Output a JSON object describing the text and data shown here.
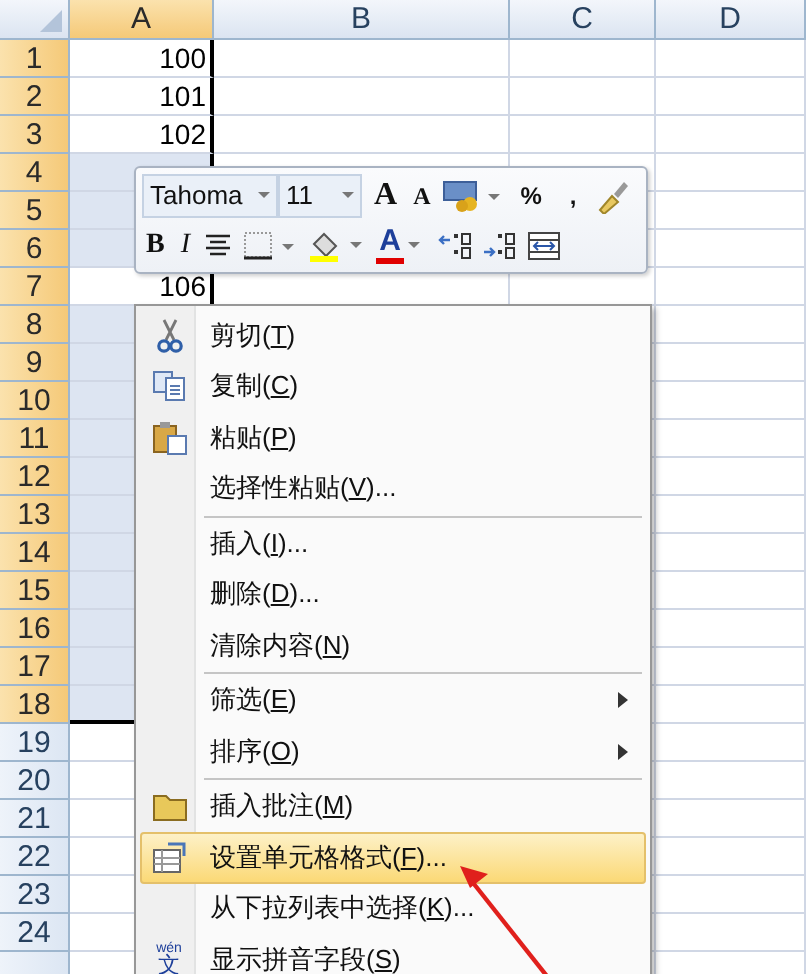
{
  "columns": [
    {
      "label": "A",
      "selected": true
    },
    {
      "label": "B",
      "selected": false
    },
    {
      "label": "C",
      "selected": false
    },
    {
      "label": "D",
      "selected": false
    }
  ],
  "rows": [
    {
      "number": "1",
      "selected": true,
      "a": "100"
    },
    {
      "number": "2",
      "selected": true,
      "a": "101"
    },
    {
      "number": "3",
      "selected": true,
      "a": "102"
    },
    {
      "number": "4",
      "selected": true
    },
    {
      "number": "5",
      "selected": true
    },
    {
      "number": "6",
      "selected": true
    },
    {
      "number": "7",
      "selected": true,
      "a": "106"
    },
    {
      "number": "8",
      "selected": true
    },
    {
      "number": "9",
      "selected": true
    },
    {
      "number": "10",
      "selected": true
    },
    {
      "number": "11",
      "selected": true
    },
    {
      "number": "12",
      "selected": true
    },
    {
      "number": "13",
      "selected": true
    },
    {
      "number": "14",
      "selected": true
    },
    {
      "number": "15",
      "selected": true
    },
    {
      "number": "16",
      "selected": true
    },
    {
      "number": "17",
      "selected": true
    },
    {
      "number": "18",
      "selected": true
    },
    {
      "number": "19",
      "selected": false
    },
    {
      "number": "20",
      "selected": false
    },
    {
      "number": "21",
      "selected": false
    },
    {
      "number": "22",
      "selected": false
    },
    {
      "number": "23",
      "selected": false
    },
    {
      "number": "24",
      "selected": false
    }
  ],
  "mini_toolbar": {
    "top_row": [
      {
        "kind": "font",
        "value": "Tahoma"
      },
      {
        "kind": "size",
        "value": "11"
      },
      {
        "kind": "grow",
        "label": "A"
      },
      {
        "kind": "shrink",
        "label": "A"
      },
      {
        "kind": "accounting"
      },
      {
        "kind": "percent",
        "label": "%"
      },
      {
        "kind": "comma",
        "label": ","
      },
      {
        "kind": "painter"
      }
    ],
    "bottom_row": [
      {
        "kind": "bold",
        "label": "B"
      },
      {
        "kind": "italic",
        "label": "I"
      },
      {
        "kind": "center"
      },
      {
        "kind": "borders"
      },
      {
        "kind": "fill",
        "color": "#ffff00"
      },
      {
        "kind": "fontcolor",
        "label": "A",
        "color": "#e00000"
      },
      {
        "kind": "incdec"
      },
      {
        "kind": "decdec"
      },
      {
        "kind": "merge"
      }
    ]
  },
  "context_menu": [
    {
      "kind": "cut",
      "prefix": "剪切(",
      "key": "T",
      "suffix": ")",
      "selected": false
    },
    {
      "kind": "copy",
      "prefix": "复制(",
      "key": "C",
      "suffix": ")",
      "selected": false
    },
    {
      "kind": "paste",
      "prefix": "粘贴(",
      "key": "P",
      "suffix": ")",
      "selected": false
    },
    {
      "kind": "item",
      "prefix": "选择性粘贴(",
      "key": "V",
      "suffix": ")...",
      "selected": false
    },
    {
      "kind": "separator"
    },
    {
      "kind": "item",
      "prefix": "插入(",
      "key": "I",
      "suffix": ")...",
      "selected": false
    },
    {
      "kind": "item",
      "prefix": "删除(",
      "key": "D",
      "suffix": ")...",
      "selected": false
    },
    {
      "kind": "item",
      "prefix": "清除内容(",
      "key": "N",
      "suffix": ")",
      "selected": false
    },
    {
      "kind": "separator"
    },
    {
      "kind": "item",
      "prefix": "筛选(",
      "key": "E",
      "suffix": ")",
      "submenu": true,
      "selected": false
    },
    {
      "kind": "item",
      "prefix": "排序(",
      "key": "O",
      "suffix": ")",
      "submenu": true,
      "selected": false
    },
    {
      "kind": "separator"
    },
    {
      "kind": "comment",
      "prefix": "插入批注(",
      "key": "M",
      "suffix": ")",
      "selected": false
    },
    {
      "kind": "format",
      "prefix": "设置单元格格式(",
      "key": "F",
      "suffix": ")...",
      "selected": true
    },
    {
      "kind": "item",
      "prefix": "从下拉列表中选择(",
      "key": "K",
      "suffix": ")...",
      "selected": false
    },
    {
      "kind": "phonetic",
      "icon_ruby": "wén",
      "icon_glyph": "文",
      "prefix": "显示拼音字段(",
      "key": "S",
      "suffix": ")",
      "selected": false
    }
  ]
}
